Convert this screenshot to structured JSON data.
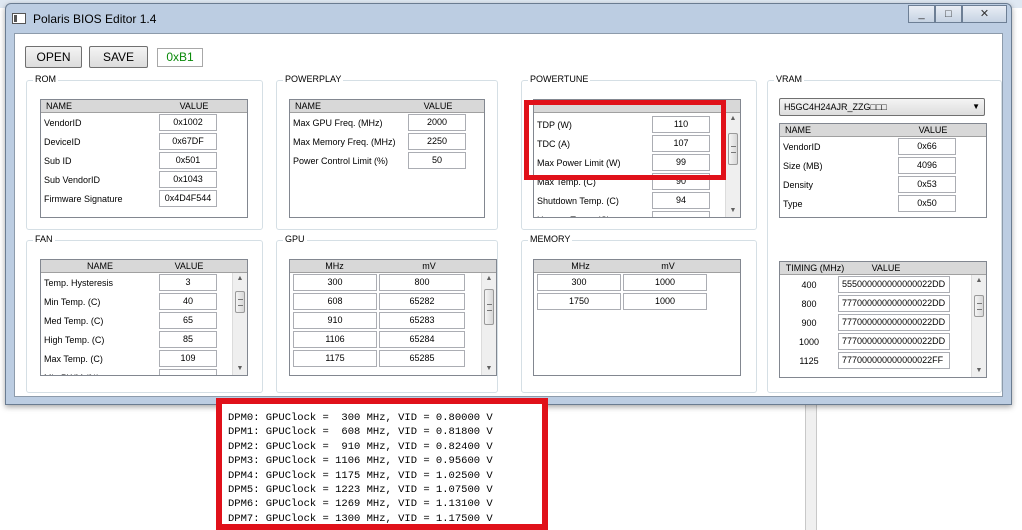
{
  "window": {
    "title": "Polaris BIOS Editor 1.4"
  },
  "toolbar": {
    "open_label": "OPEN",
    "save_label": "SAVE",
    "checksum_value": "0xB1"
  },
  "rom": {
    "title": "ROM",
    "columns": [
      "NAME",
      "VALUE"
    ],
    "rows": [
      {
        "name": "VendorID",
        "value": "0x1002"
      },
      {
        "name": "DeviceID",
        "value": "0x67DF"
      },
      {
        "name": "Sub ID",
        "value": "0x501"
      },
      {
        "name": "Sub VendorID",
        "value": "0x1043"
      },
      {
        "name": "Firmware Signature",
        "value": "0x4D4F544"
      }
    ]
  },
  "powerplay": {
    "title": "POWERPLAY",
    "columns": [
      "NAME",
      "VALUE"
    ],
    "rows": [
      {
        "name": "Max GPU Freq. (MHz)",
        "value": "2000"
      },
      {
        "name": "Max Memory Freq. (MHz)",
        "value": "2250"
      },
      {
        "name": "Power Control Limit (%)",
        "value": "50"
      }
    ]
  },
  "powertune": {
    "title": "POWERTUNE",
    "rows": [
      {
        "name": "TDP (W)",
        "value": "110"
      },
      {
        "name": "TDC (A)",
        "value": "107"
      },
      {
        "name": "Max Power Limit (W)",
        "value": "99"
      },
      {
        "name": "Max Temp. (C)",
        "value": "90"
      },
      {
        "name": "Shutdown Temp. (C)",
        "value": "94"
      },
      {
        "name": "Hotspot Temp. (C)",
        "value": ""
      }
    ]
  },
  "vram": {
    "title": "VRAM",
    "selected": "H5GC4H24AJR_ZZG□□□",
    "columns": [
      "NAME",
      "VALUE"
    ],
    "rows": [
      {
        "name": "VendorID",
        "value": "0x66"
      },
      {
        "name": "Size (MB)",
        "value": "4096"
      },
      {
        "name": "Density",
        "value": "0x53"
      },
      {
        "name": "Type",
        "value": "0x50"
      }
    ]
  },
  "fan": {
    "title": "FAN",
    "columns": [
      "NAME",
      "VALUE"
    ],
    "rows": [
      {
        "name": "Temp. Hysteresis",
        "value": "3"
      },
      {
        "name": "Min Temp. (C)",
        "value": "40"
      },
      {
        "name": "Med Temp. (C)",
        "value": "65"
      },
      {
        "name": "High Temp. (C)",
        "value": "85"
      },
      {
        "name": "Max Temp. (C)",
        "value": "109"
      },
      {
        "name": "Min PWM (%)",
        "value": ""
      }
    ]
  },
  "gpu": {
    "title": "GPU",
    "columns": [
      "MHz",
      "mV"
    ],
    "rows": [
      {
        "mhz": "300",
        "mv": "800"
      },
      {
        "mhz": "608",
        "mv": "65282"
      },
      {
        "mhz": "910",
        "mv": "65283"
      },
      {
        "mhz": "1106",
        "mv": "65284"
      },
      {
        "mhz": "1175",
        "mv": "65285"
      }
    ]
  },
  "memory": {
    "title": "MEMORY",
    "columns": [
      "MHz",
      "mV"
    ],
    "rows": [
      {
        "mhz": "300",
        "mv": "1000"
      },
      {
        "mhz": "1750",
        "mv": "1000"
      }
    ]
  },
  "timing": {
    "columns": [
      "TIMING (MHz)",
      "VALUE"
    ],
    "rows": [
      {
        "mhz": "400",
        "value": "555000000000000022DD"
      },
      {
        "mhz": "800",
        "value": "777000000000000022DD"
      },
      {
        "mhz": "900",
        "value": "777000000000000022DD"
      },
      {
        "mhz": "1000",
        "value": "777000000000000022DD"
      },
      {
        "mhz": "1125",
        "value": "777000000000000022FF"
      }
    ]
  },
  "console": {
    "lines": [
      "DPM0: GPUClock =  300 MHz, VID = 0.80000 V",
      "DPM1: GPUClock =  608 MHz, VID = 0.81800 V",
      "DPM2: GPUClock =  910 MHz, VID = 0.82400 V",
      "DPM3: GPUClock = 1106 MHz, VID = 0.95600 V",
      "DPM4: GPUClock = 1175 MHz, VID = 1.02500 V",
      "DPM5: GPUClock = 1223 MHz, VID = 1.07500 V",
      "DPM6: GPUClock = 1269 MHz, VID = 1.13100 V",
      "DPM7: GPUClock = 1300 MHz, VID = 1.17500 V"
    ]
  },
  "colors": {
    "highlight": "#e0111a",
    "checksum": "#0a8a0a",
    "title_bar": "#bccde2"
  }
}
